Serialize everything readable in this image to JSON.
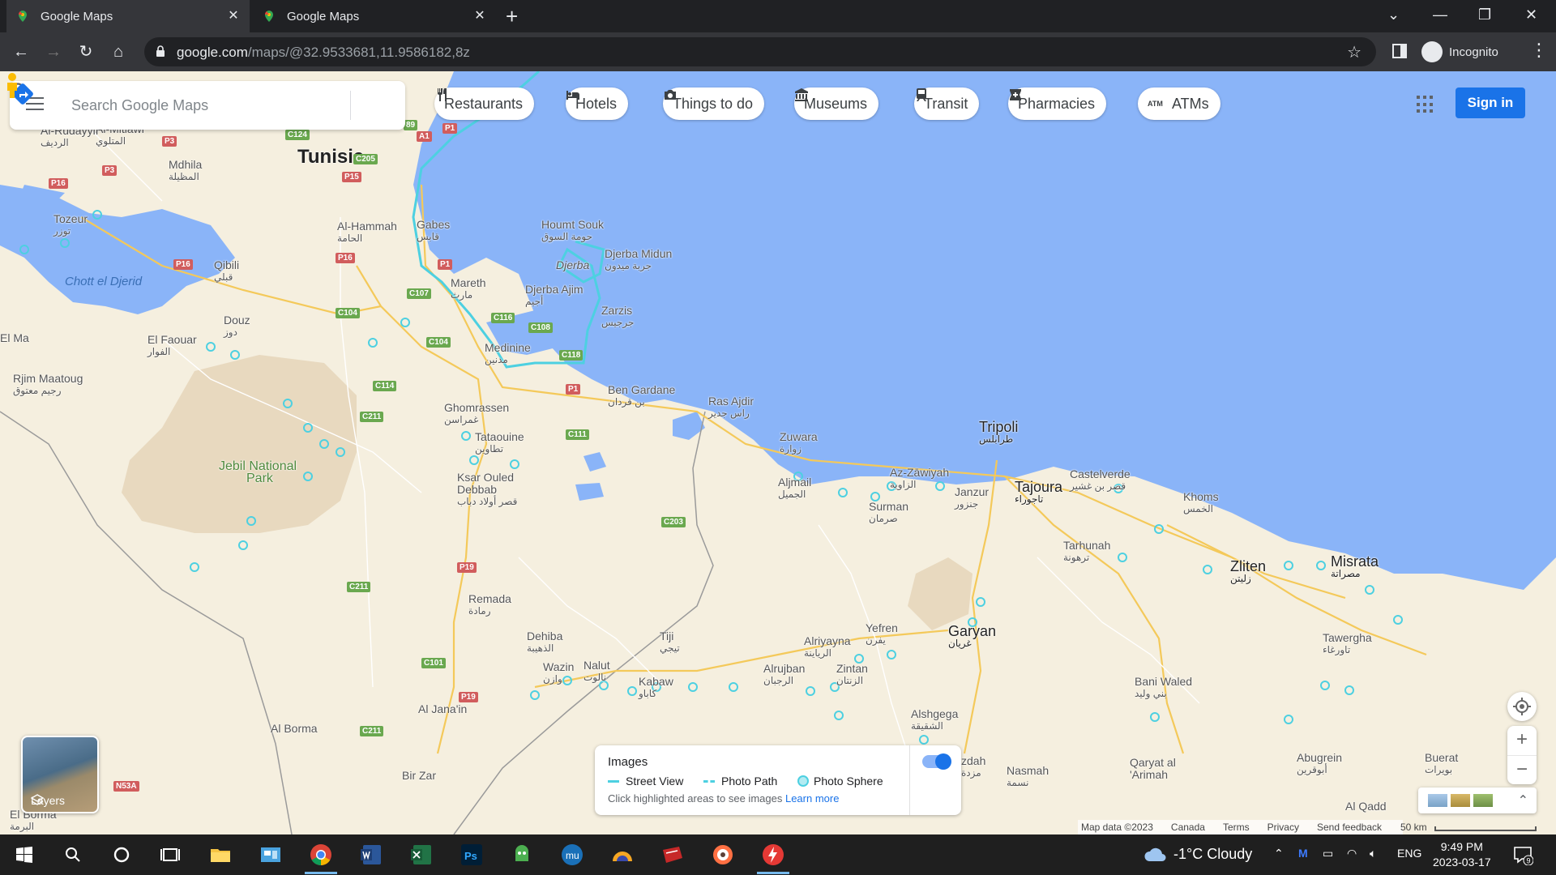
{
  "browser": {
    "tabs": [
      {
        "title": "Google Maps",
        "active": true
      },
      {
        "title": "Google Maps",
        "active": false
      }
    ],
    "url_host": "google.com",
    "url_path": "/maps/@32.9533681,11.9586182,8z",
    "profile_label": "Incognito"
  },
  "search": {
    "placeholder": "Search Google Maps"
  },
  "chips": [
    {
      "label": "Restaurants",
      "icon": "fork-knife-icon"
    },
    {
      "label": "Hotels",
      "icon": "bed-icon"
    },
    {
      "label": "Things to do",
      "icon": "camera-icon"
    },
    {
      "label": "Museums",
      "icon": "museum-icon"
    },
    {
      "label": "Transit",
      "icon": "train-icon"
    },
    {
      "label": "Pharmacies",
      "icon": "pharmacy-icon"
    },
    {
      "label": "ATMs",
      "icon": "atm-icon"
    }
  ],
  "signin_label": "Sign in",
  "layers_label": "Layers",
  "map_labels": {
    "tunisia": "Tunisia",
    "tripoli": "Tripoli",
    "tripoli_ar": "طرابلس",
    "tozeur": "Tozeur",
    "tozeur_ar": "توزر",
    "chott": "Chott el Djerid",
    "douz": "Douz",
    "douz_ar": "دوز",
    "el_faouar": "El Faouar",
    "el_faouar_ar": "الفوار",
    "qibili": "Qibili",
    "qibili_ar": "قبلي",
    "mdhila": "Mdhila",
    "mdhila_ar": "المظيلة",
    "al_mitlawi": "Al-Mitlawi",
    "al_mitlawi_ar": "المتلوي",
    "redeyef": "Al-Rudayyif",
    "redeyef_ar": "الرديف",
    "al_hammah": "Al-Hammah",
    "al_hammah_ar": "الحامة",
    "gabes": "Gabes",
    "gabes_ar": "قابس",
    "mareth": "Mareth",
    "mareth_ar": "مارث",
    "houmt_souk": "Houmt Souk",
    "houmt_souk_ar": "حومة السوق",
    "djerba": "Djerba",
    "djerba_midun": "Djerba Midun",
    "djerba_midun_ar": "جربة ميدون",
    "djerba_ajim": "Djerba Ajim",
    "djerba_ajim_ar": "أجيم",
    "zarzis": "Zarzis",
    "zarzis_ar": "جرجيس",
    "medinine": "Medinine",
    "medinine_ar": "مدنين",
    "ben_gardane": "Ben Gardane",
    "ben_gardane_ar": "بن قردان",
    "ras_ajdir": "Ras Ajdir",
    "ras_ajdir_ar": "راس جدير",
    "ghomrassen": "Ghomrassen",
    "ghomrassen_ar": "غمراسن",
    "tataouine": "Tataouine",
    "tataouine_ar": "تطاوين",
    "ksar_ouled": "Ksar Ouled",
    "debbab": "Debbab",
    "debbab_ar": "قصر أولاد دباب",
    "rjim": "Rjim Maatoug",
    "rjim_ar": "رجيم معتوق",
    "el_ma": "El Ma",
    "jebil": "Jebil National",
    "park": "Park",
    "remada": "Remada",
    "remada_ar": "رمادة",
    "dehiba": "Dehiba",
    "dehiba_ar": "الذهيبة",
    "wazin": "Wazin",
    "wazin_ar": "وازن",
    "nalut": "Nalut",
    "nalut_ar": "نالوت",
    "tiji": "Tiji",
    "tiji_ar": "تيجي",
    "kabaw": "Kabaw",
    "kabaw_ar": "كاباو",
    "al_janain": "Al Jana'in",
    "al_borma": "Al Borma",
    "bir_zar": "Bir Zar",
    "el_borma": "El Borma",
    "el_borma_ar": "البرمة",
    "zuwara": "Zuwara",
    "zuwara_ar": "زوارة",
    "aljmail": "Aljmail",
    "aljmail_ar": "الجميل",
    "az_zawiyah": "Az-Zāwiyah",
    "az_zawiyah_ar": "الزاوية",
    "surman": "Surman",
    "surman_ar": "صرمان",
    "janzur": "Janzur",
    "janzur_ar": "جنزور",
    "tajoura": "Tajoura",
    "tajoura_ar": "تاجوراء",
    "castelverde": "Castelverde",
    "castelverde_ar": "قصر بن غشير",
    "khoms": "Khoms",
    "khoms_ar": "الخمس",
    "tarhunah": "Tarhunah",
    "tarhunah_ar": "ترهونة",
    "zliten": "Zliten",
    "zliten_ar": "زليتن",
    "misrata": "Misrata",
    "misrata_ar": "مصراتة",
    "tawergha": "Tawergha",
    "tawergha_ar": "تاورغاء",
    "bani_waled": "Bani Waled",
    "bani_waled_ar": "بني وليد",
    "garyan": "Garyan",
    "garyan_ar": "غريان",
    "yefren": "Yefren",
    "yefren_ar": "يفرن",
    "alriyayna": "Alriyayna",
    "alriyayna_ar": "الرياينة",
    "alrujban": "Alrujban",
    "alrujban_ar": "الرجبان",
    "zintan": "Zintan",
    "zintan_ar": "الزنتان",
    "alshgega": "Alshgega",
    "alshgega_ar": "الشقيقة",
    "mizdah": "zdah",
    "mizdah_ar": "مزدة",
    "nasmah": "Nasmah",
    "nasmah_ar": "نسمة",
    "qaryat": "Qaryat al",
    "arimah": "'Arimah",
    "abugrein": "Abugrein",
    "abugrein_ar": "أبوقرين",
    "buerat": "Buerat",
    "buerat_ar": "بويرات",
    "al_qaddah": "Al Qadd"
  },
  "road_shields": [
    {
      "label": "P1",
      "color": "red"
    },
    {
      "label": "A1",
      "color": "red"
    },
    {
      "label": "P3",
      "color": "red"
    },
    {
      "label": "P3",
      "color": "red"
    },
    {
      "label": "P16",
      "color": "red"
    },
    {
      "label": "P15",
      "color": "red"
    },
    {
      "label": "P16",
      "color": "red"
    },
    {
      "label": "P16",
      "color": "red"
    },
    {
      "label": "P1",
      "color": "red"
    },
    {
      "label": "P1",
      "color": "red"
    },
    {
      "label": "P19",
      "color": "red"
    },
    {
      "label": "P19",
      "color": "red"
    },
    {
      "label": "N53A",
      "color": "red"
    },
    {
      "label": "C124",
      "color": "green"
    },
    {
      "label": "C205",
      "color": "green"
    },
    {
      "label": "C107",
      "color": "green"
    },
    {
      "label": "C104",
      "color": "green"
    },
    {
      "label": "C104",
      "color": "green"
    },
    {
      "label": "C116",
      "color": "green"
    },
    {
      "label": "C108",
      "color": "green"
    },
    {
      "label": "C118",
      "color": "green"
    },
    {
      "label": "C114",
      "color": "green"
    },
    {
      "label": "C211",
      "color": "green"
    },
    {
      "label": "C111",
      "color": "green"
    },
    {
      "label": "C203",
      "color": "green"
    },
    {
      "label": "C211",
      "color": "green"
    },
    {
      "label": "C101",
      "color": "green"
    },
    {
      "label": "C211",
      "color": "green"
    },
    {
      "label": "89",
      "color": "green"
    }
  ],
  "images_panel": {
    "title": "Images",
    "street_view": "Street View",
    "photo_path": "Photo Path",
    "photo_sphere": "Photo Sphere",
    "hint": "Click highlighted areas to see images",
    "learn_more": "Learn more"
  },
  "attribution": {
    "map_data": "Map data ©2023",
    "country": "Canada",
    "terms": "Terms",
    "privacy": "Privacy",
    "feedback": "Send feedback",
    "scale": "50 km"
  },
  "taskbar": {
    "weather": "-1°C  Cloudy",
    "lang": "ENG",
    "time": "9:49 PM",
    "date": "2023-03-17",
    "notifications": "9"
  },
  "colors": {
    "water": "#8ab4f8",
    "land": "#f5efdf",
    "accent": "#1a73e8"
  }
}
